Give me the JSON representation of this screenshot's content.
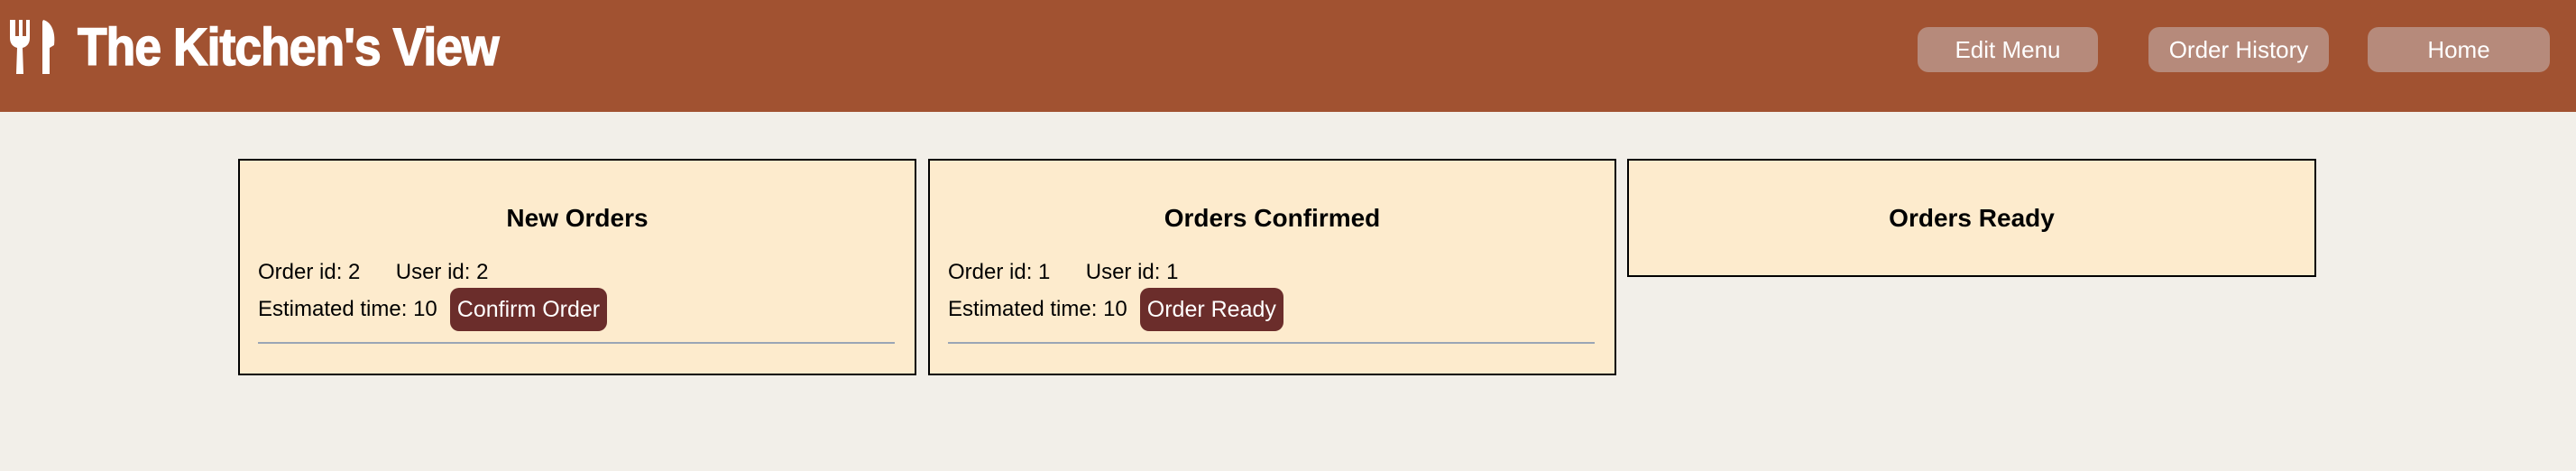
{
  "header": {
    "title": "The Kitchen's View",
    "logo_icon": "fork-knife-icon",
    "nav": {
      "edit_menu": "Edit Menu",
      "order_history": "Order History",
      "home": "Home"
    },
    "colors": {
      "bar": "#a15231",
      "nav_button": "#b68a7b"
    }
  },
  "columns": {
    "new": {
      "title": "New Orders",
      "orders": [
        {
          "order_id_label": "Order id:",
          "order_id": "2",
          "user_id_label": "User id:",
          "user_id": "2",
          "estimated_label": "Estimated time:",
          "estimated_time": "10",
          "action": "Confirm Order"
        }
      ]
    },
    "confirmed": {
      "title": "Orders Confirmed",
      "orders": [
        {
          "order_id_label": "Order id:",
          "order_id": "1",
          "user_id_label": "User id:",
          "user_id": "1",
          "estimated_label": "Estimated time:",
          "estimated_time": "10",
          "action": "Order Ready"
        }
      ]
    },
    "ready": {
      "title": "Orders Ready",
      "orders": []
    }
  },
  "colors": {
    "page_bg": "#f2efe9",
    "card_bg": "#fdebcd",
    "action_button": "#6b2d2b"
  }
}
